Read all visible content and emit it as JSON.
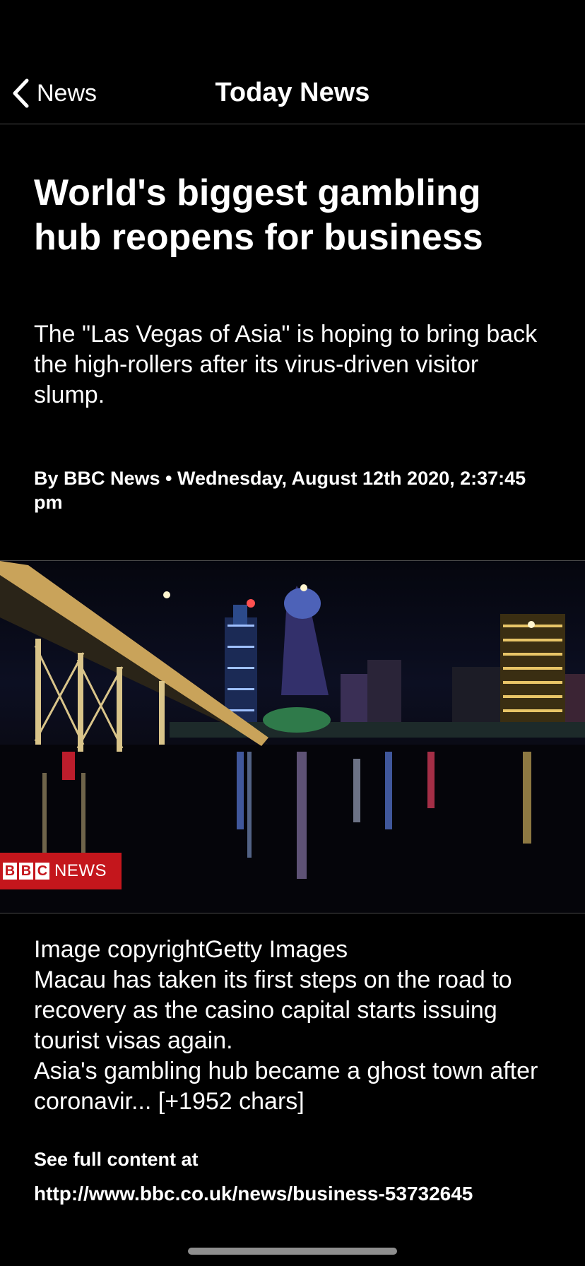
{
  "navbar": {
    "back_label": "News",
    "title": "Today News"
  },
  "article": {
    "headline": "World's biggest gambling hub reopens for business",
    "summary": "The \"Las Vegas of Asia\" is hoping to bring back the high-rollers after its virus-driven visitor slump.",
    "byline": "By BBC News • Wednesday, August 12th 2020, 2:37:45 pm",
    "image": {
      "badge_letters": [
        "B",
        "B",
        "C"
      ],
      "badge_text": "NEWS",
      "badge_color": "#c4161c"
    },
    "body": "Image copyrightGetty Images\nMacau has taken its first steps on the road to recovery as the casino capital starts issuing tourist visas again.\nAsia's gambling hub became a ghost town after coronavir... [+1952 chars]",
    "see_full_label": "See full content at",
    "source_url": "http://www.bbc.co.uk/news/business-53732645"
  },
  "icons": {
    "back": "chevron-left-icon"
  }
}
